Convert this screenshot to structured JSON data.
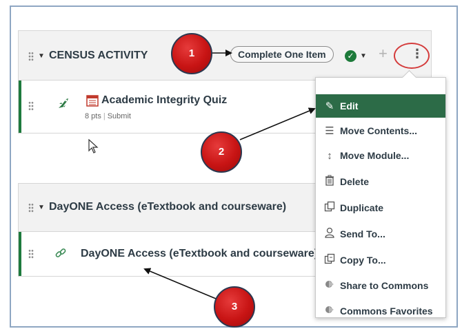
{
  "module1": {
    "title": "CENSUS ACTIVITY",
    "requirement": "Complete One Item",
    "item": {
      "title": "Academic Integrity Quiz",
      "points": "8 pts",
      "type": "Submit"
    }
  },
  "module2": {
    "title": "DayONE Access (eTextbook and courseware)",
    "item": {
      "title": "DayONE Access (eTextbook and courseware)"
    }
  },
  "menu": {
    "items": [
      {
        "label": "Edit",
        "icon": "pencil-icon"
      },
      {
        "label": "Move Contents...",
        "icon": "move-contents-icon"
      },
      {
        "label": "Move Module...",
        "icon": "updown-arrow-icon"
      },
      {
        "label": "Delete",
        "icon": "trash-icon"
      },
      {
        "label": "Duplicate",
        "icon": "duplicate-icon"
      },
      {
        "label": "Send To...",
        "icon": "user-icon"
      },
      {
        "label": "Copy To...",
        "icon": "copy-icon"
      },
      {
        "label": "Share to Commons",
        "icon": "commons-icon"
      },
      {
        "label": "Commons Favorites",
        "icon": "commons-icon"
      }
    ]
  },
  "callouts": [
    "1",
    "2",
    "3"
  ],
  "colors": {
    "accent_green": "#2c6b47",
    "callout_red": "#c81414",
    "item_border": "#1e7a3d"
  }
}
